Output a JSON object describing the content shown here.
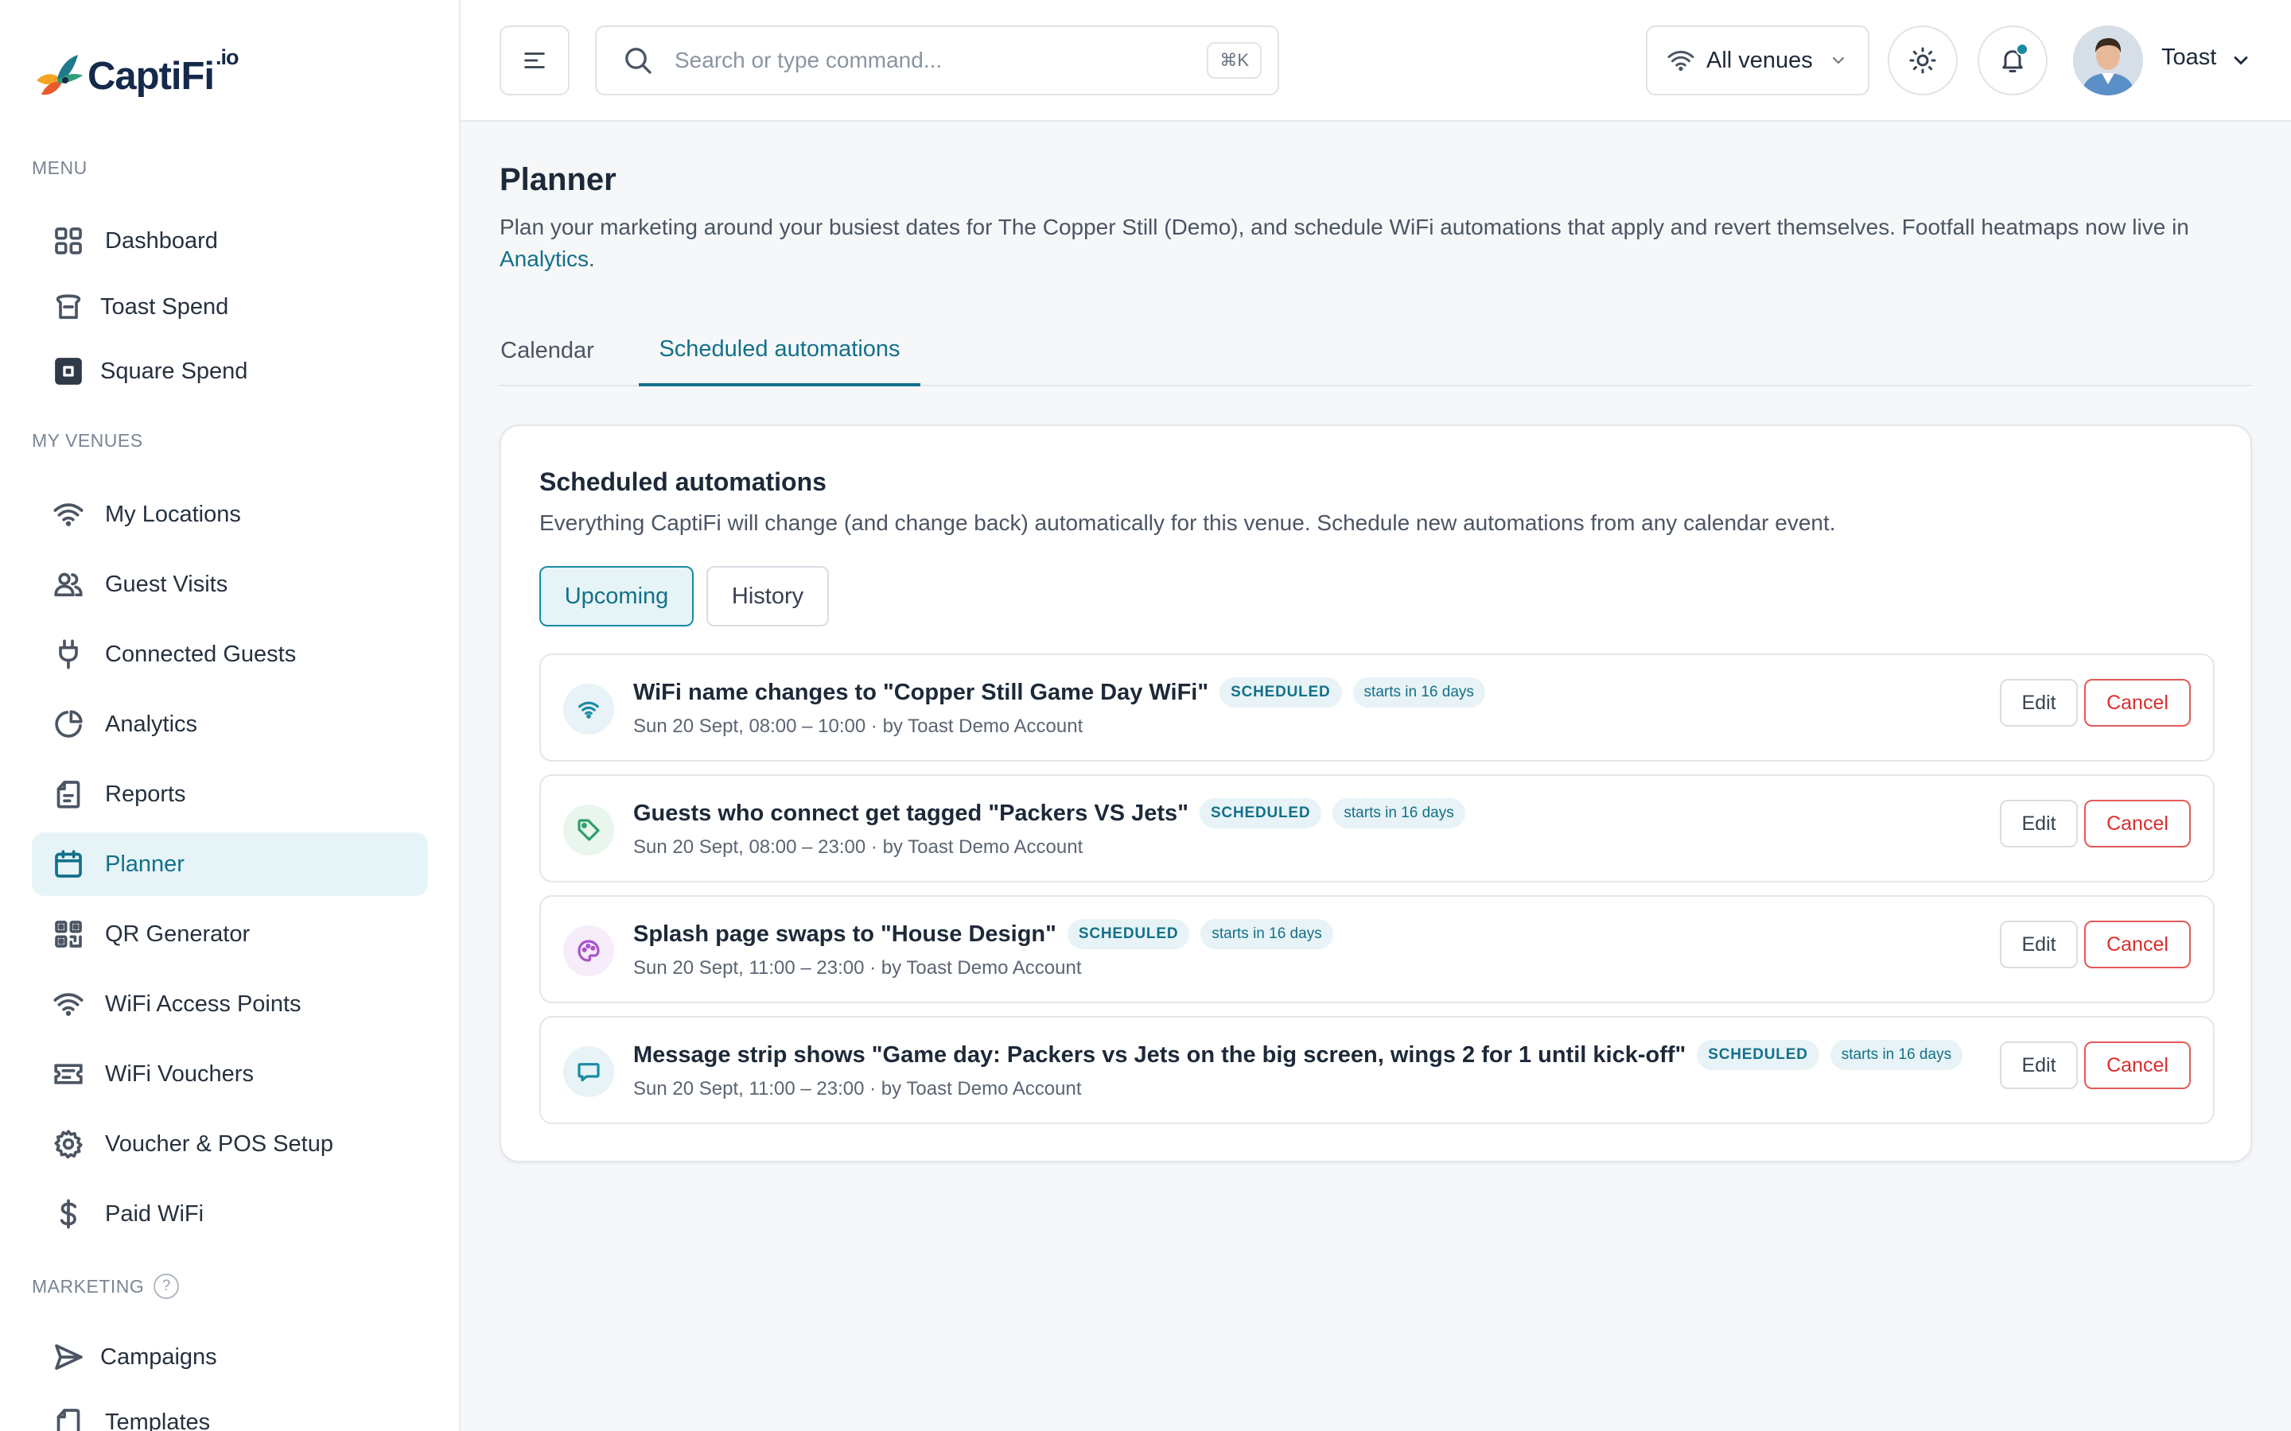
{
  "brand": {
    "name": "CaptiFi",
    "suffix": ".io"
  },
  "sidebar": {
    "sections": [
      {
        "label": "MENU"
      },
      {
        "label": "MY VENUES"
      },
      {
        "label": "MARKETING",
        "help": "?"
      }
    ],
    "menu": [
      {
        "label": "Dashboard",
        "icon": "grid-icon"
      },
      {
        "label": "Toast Spend",
        "icon": "toast-icon"
      },
      {
        "label": "Square Spend",
        "icon": "square-icon"
      }
    ],
    "venues": [
      {
        "label": "My Locations",
        "icon": "wifi-icon"
      },
      {
        "label": "Guest Visits",
        "icon": "users-icon"
      },
      {
        "label": "Connected Guests",
        "icon": "plug-icon"
      },
      {
        "label": "Analytics",
        "icon": "pie-chart-icon"
      },
      {
        "label": "Reports",
        "icon": "report-icon"
      },
      {
        "label": "Planner",
        "icon": "calendar-icon",
        "active": true
      },
      {
        "label": "QR Generator",
        "icon": "qr-icon"
      },
      {
        "label": "WiFi Access Points",
        "icon": "wifi-icon"
      },
      {
        "label": "WiFi Vouchers",
        "icon": "voucher-icon"
      },
      {
        "label": "Voucher & POS Setup",
        "icon": "gear-icon"
      },
      {
        "label": "Paid WiFi",
        "icon": "dollar-icon"
      }
    ],
    "marketing": [
      {
        "label": "Campaigns",
        "icon": "send-icon"
      },
      {
        "label": "Templates",
        "icon": "template-icon"
      }
    ]
  },
  "topbar": {
    "search_placeholder": "Search or type command...",
    "shortcut": "⌘K",
    "venue_select": "All venues",
    "user_name": "Toast"
  },
  "page": {
    "title": "Planner",
    "description": "Plan your marketing around your busiest dates for The Copper Still (Demo), and schedule WiFi automations that apply and revert themselves. Footfall heatmaps now live in",
    "description_link": "Analytics",
    "description_end": ".",
    "tabs": [
      {
        "label": "Calendar",
        "active": false
      },
      {
        "label": "Scheduled automations",
        "active": true
      }
    ]
  },
  "card": {
    "title": "Scheduled automations",
    "description": "Everything CaptiFi will change (and change back) automatically for this venue. Schedule new automations from any calendar event.",
    "filters": [
      {
        "label": "Upcoming",
        "active": true
      },
      {
        "label": "History",
        "active": false
      }
    ],
    "automations": [
      {
        "icon": "wifi-icon",
        "title": "WiFi name changes to \"Copper Still Game Day WiFi\"",
        "status": "SCHEDULED",
        "starts": "starts in 16 days",
        "subtitle": "Sun 20 Sept, 08:00 – 10:00 · by Toast Demo Account",
        "edit": "Edit",
        "cancel": "Cancel"
      },
      {
        "icon": "tag-icon",
        "title": "Guests who connect get tagged \"Packers VS Jets\"",
        "status": "SCHEDULED",
        "starts": "starts in 16 days",
        "subtitle": "Sun 20 Sept, 08:00 – 23:00 · by Toast Demo Account",
        "edit": "Edit",
        "cancel": "Cancel"
      },
      {
        "icon": "palette-icon",
        "title": "Splash page swaps to \"House Design\"",
        "status": "SCHEDULED",
        "starts": "starts in 16 days",
        "subtitle": "Sun 20 Sept, 11:00 – 23:00 · by Toast Demo Account",
        "edit": "Edit",
        "cancel": "Cancel"
      },
      {
        "icon": "message-icon",
        "title": "Message strip shows \"Game day: Packers vs Jets on the big screen, wings 2 for 1 until kick-off\"",
        "status": "SCHEDULED",
        "starts": "starts in 16 days",
        "subtitle": "Sun 20 Sept, 11:00 – 23:00 · by Toast Demo Account",
        "edit": "Edit",
        "cancel": "Cancel"
      }
    ]
  },
  "colors": {
    "accent": "#13708a",
    "active_bg": "#e6f4f7",
    "danger": "#d92d2d",
    "wifi_icon": "#1a8aa5",
    "tag_icon": "#2e9e6a",
    "palette_icon": "#a855c7",
    "message_icon": "#1a8aa5"
  }
}
